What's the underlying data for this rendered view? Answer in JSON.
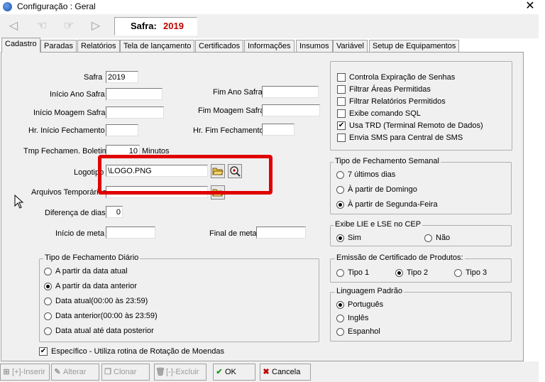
{
  "window": {
    "title": "Configuração : Geral",
    "close_symbol": "✕"
  },
  "toolbar": {
    "safra_label": "Safra:",
    "safra_value": "2019"
  },
  "tabs": [
    {
      "label": "Cadastro"
    },
    {
      "label": "Paradas"
    },
    {
      "label": "Relatórios"
    },
    {
      "label": "Tela de lançamento"
    },
    {
      "label": "Certificados"
    },
    {
      "label": "Informações"
    },
    {
      "label": "Insumos"
    },
    {
      "label": "Variável"
    },
    {
      "label": "Setup de Equipamentos"
    }
  ],
  "form": {
    "safra": {
      "label": "Safra",
      "value": "2019"
    },
    "inicio_ano_safra": {
      "label": "Início Ano Safra",
      "value": ""
    },
    "fim_ano_safra": {
      "label": "Fim Ano Safra",
      "value": ""
    },
    "inicio_moagem_safra": {
      "label": "Início Moagem Safra",
      "value": ""
    },
    "fim_moagem_safra": {
      "label": "Fim Moagem Safra",
      "value": ""
    },
    "hr_inicio_fechamento": {
      "label": "Hr. Início Fechamento",
      "value": ""
    },
    "hr_fim_fechamento": {
      "label": "Hr. Fim Fechamento",
      "value": ""
    },
    "tmp_fechamento_boletim": {
      "label": "Tmp Fechamen. Boletim",
      "value": "10",
      "unit": "Minutos"
    },
    "logotipo": {
      "label": "Logotipo",
      "value": "\\LOGO.PNG"
    },
    "arquivos_temporarios": {
      "label": "Arquivos Temporários",
      "value": ""
    },
    "diferenca_de_dias": {
      "label": "Diferença de dias",
      "value": "0"
    },
    "inicio_de_meta": {
      "label": "Início de meta",
      "value": ""
    },
    "final_de_meta": {
      "label": "Final de meta",
      "value": ""
    }
  },
  "fechamento_diario": {
    "title": "Tipo de Fechamento Diário",
    "options": [
      {
        "label": "A partir da data atual",
        "selected": false
      },
      {
        "label": "A partir da data anterior",
        "selected": true
      },
      {
        "label": "Data atual(00:00 às 23:59)",
        "selected": false
      },
      {
        "label": "Data anterior(00:00 às 23:59)",
        "selected": false
      },
      {
        "label": "Data atual até data posterior",
        "selected": false
      }
    ]
  },
  "especifico": {
    "label": "Específico - Utiliza rotina de Rotação de Moendas",
    "checked": true
  },
  "checkboxes": [
    {
      "label": "Controla Expiração de Senhas",
      "checked": false
    },
    {
      "label": "Filtrar Áreas Permitidas",
      "checked": false
    },
    {
      "label": "Filtrar Relatórios Permitidos",
      "checked": false
    },
    {
      "label": "Exibe comando SQL",
      "checked": false
    },
    {
      "label": "Usa TRD (Terminal Remoto de Dados)",
      "checked": true
    },
    {
      "label": "Envia SMS para Central de SMS",
      "checked": false
    }
  ],
  "fechamento_semanal": {
    "title": "Tipo de Fechamento Semanal",
    "options": [
      {
        "label": "7 últimos dias",
        "selected": false
      },
      {
        "label": "À partir de Domingo",
        "selected": false
      },
      {
        "label": "À partir de Segunda-Feira",
        "selected": true
      }
    ]
  },
  "exibe_lie": {
    "title": "Exibe LIE e LSE no CEP",
    "options": [
      {
        "label": "Sim",
        "selected": true
      },
      {
        "label": "Não",
        "selected": false
      }
    ]
  },
  "emissao_certificado": {
    "title": "Emissão de Certificado de Produtos:",
    "options": [
      {
        "label": "Tipo 1",
        "selected": false
      },
      {
        "label": "Tipo 2",
        "selected": true
      },
      {
        "label": "Tipo 3",
        "selected": false
      }
    ]
  },
  "linguagem": {
    "title": "Linguagem Padrão",
    "options": [
      {
        "label": "Português",
        "selected": true
      },
      {
        "label": "Inglês",
        "selected": false
      },
      {
        "label": "Espanhol",
        "selected": false
      }
    ]
  },
  "bottom_buttons": {
    "inserir": "[+]-Inserir",
    "alterar": "Alterar",
    "clonar": "Clonar",
    "excluir": "[-]-Excluir",
    "ok": "OK",
    "cancela": "Cancela"
  },
  "colors": {
    "accent_red": "#c00000",
    "ok_green": "#1a9a1a",
    "highlight": "#e00000"
  }
}
